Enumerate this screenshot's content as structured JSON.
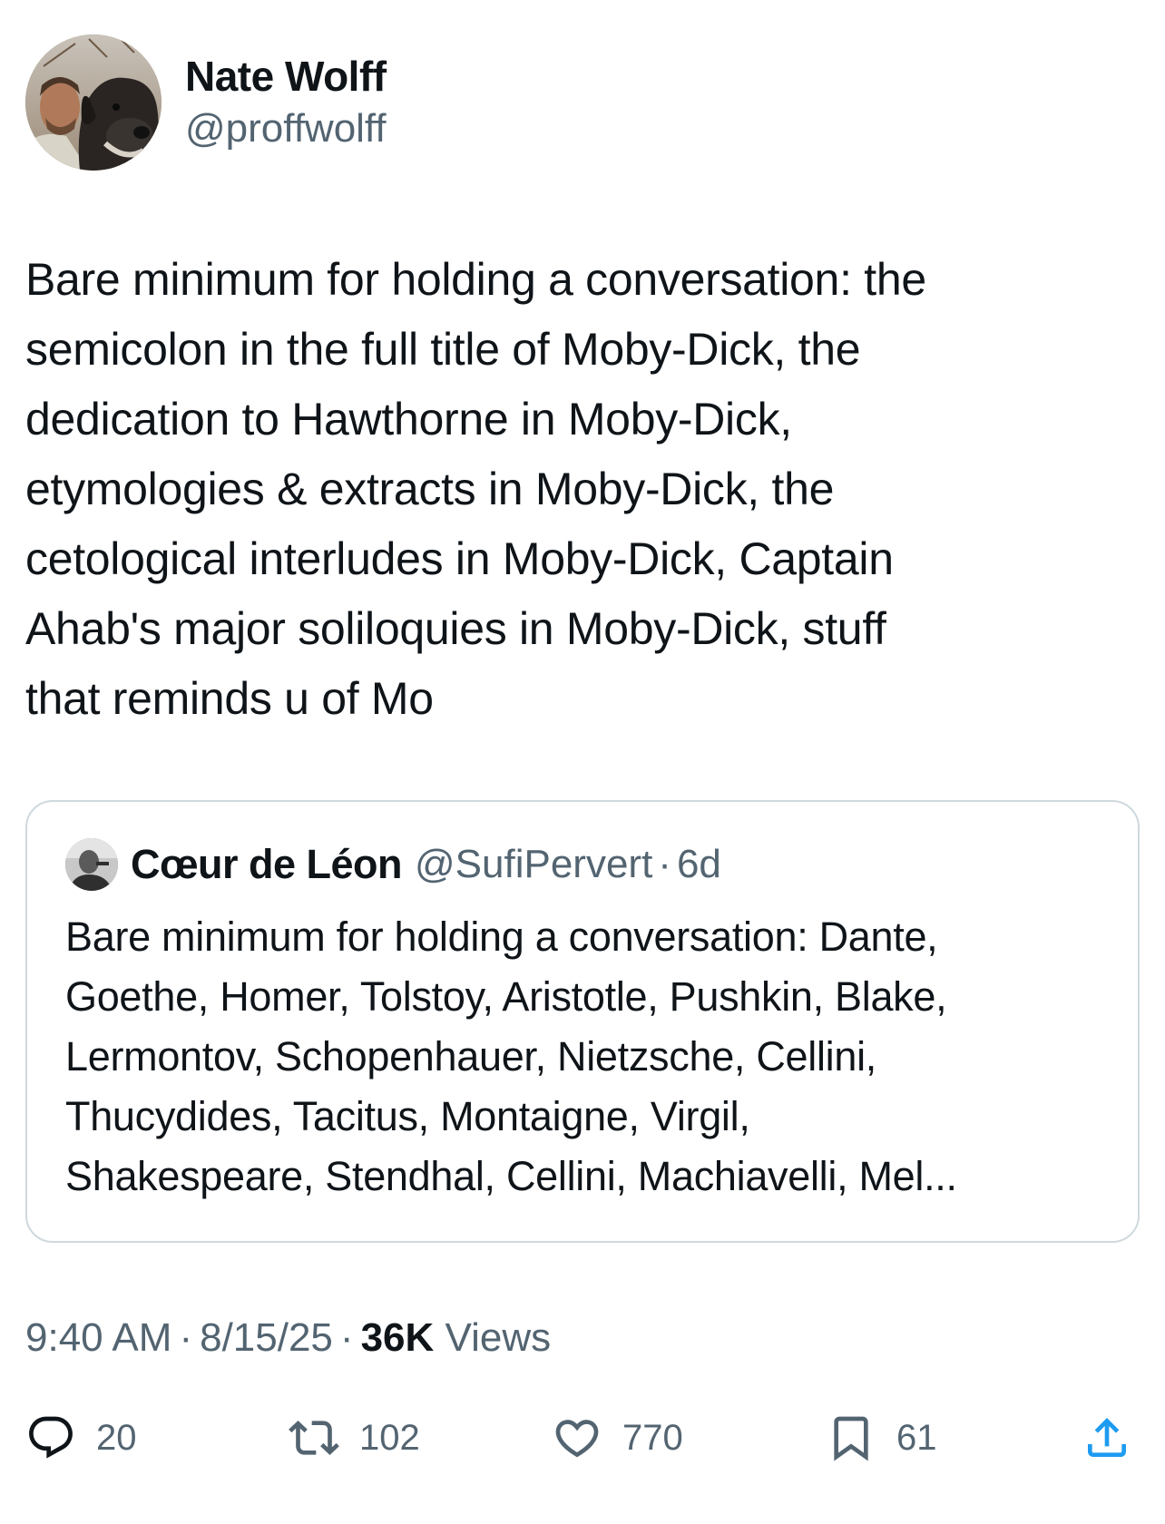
{
  "author": {
    "display_name": "Nate Wolff",
    "handle": "@proffwolff",
    "avatar_icon": "profile-photo-man-with-dog"
  },
  "tweet": {
    "text": "Bare minimum for holding a conversation: the\nsemicolon in the full title of Moby-Dick, the\ndedication to Hawthorne in Moby-Dick,\netymologies & extracts in Moby-Dick, the\ncetological interludes in Moby-Dick, Captain\nAhab's major soliloquies in Moby-Dick, stuff\nthat reminds u of Mo"
  },
  "quote": {
    "display_name": "Cœur de Léon",
    "handle": "@SufiPervert",
    "separator": "·",
    "time": "6d",
    "avatar_icon": "profile-photo-grayscale",
    "text": "Bare minimum for holding a conversation: Dante,\nGoethe, Homer, Tolstoy, Aristotle, Pushkin, Blake,\nLermontov, Schopenhauer, Nietzsche, Cellini,\nThucydides, Tacitus, Montaigne, Virgil,\nShakespeare, Stendhal, Cellini, Machiavelli, Mel..."
  },
  "meta": {
    "time": "9:40 AM",
    "separator": "·",
    "date": "8/15/25",
    "views_count": "36K",
    "views_label": "Views"
  },
  "actions": {
    "reply": {
      "icon": "reply-icon",
      "count": "20"
    },
    "retweet": {
      "icon": "retweet-icon",
      "count": "102"
    },
    "like": {
      "icon": "heart-icon",
      "count": "770"
    },
    "bookmark": {
      "icon": "bookmark-icon",
      "count": "61"
    },
    "share": {
      "icon": "share-icon"
    }
  },
  "colors": {
    "text_primary": "#0f1419",
    "text_secondary": "#536471",
    "border": "#cfd9de",
    "background": "#ffffff"
  }
}
